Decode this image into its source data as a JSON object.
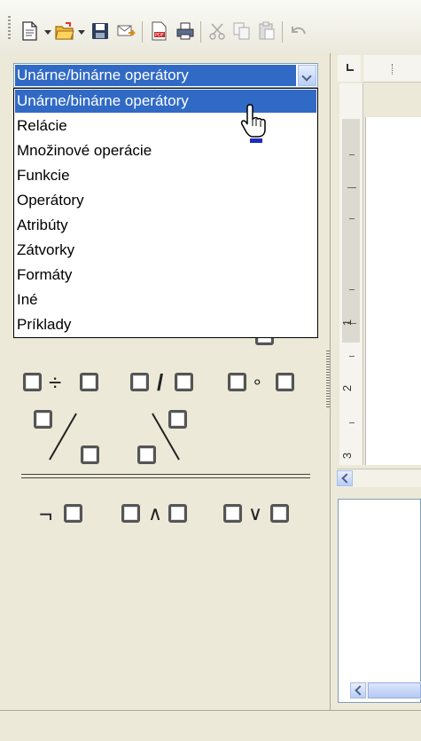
{
  "toolbar": {
    "buttons": [
      "new-document-icon",
      "open-folder-icon",
      "save-icon",
      "email-icon",
      "export-pdf-icon",
      "print-icon",
      "cut-icon",
      "copy-icon",
      "paste-icon",
      "undo-icon"
    ]
  },
  "elements_panel": {
    "category_selected": "Unárne/binárne operátory",
    "dropdown_options": [
      "Unárne/binárne operátory",
      "Relácie",
      "Množinové operácie",
      "Funkcie",
      "Operátory",
      "Atribúty",
      "Zátvorky",
      "Formáty",
      "Iné",
      "Príklady"
    ],
    "highlighted_index": 0,
    "operators": {
      "divide": "÷",
      "slash": "/",
      "circle": "∘",
      "not": "¬",
      "and": "∧",
      "or": "∨"
    }
  },
  "ruler": {
    "vertical_labels": [
      "1",
      "2",
      "3"
    ]
  },
  "colors": {
    "selection": "#316ac5",
    "chrome": "#ece9d8",
    "border": "#7f9db9"
  }
}
